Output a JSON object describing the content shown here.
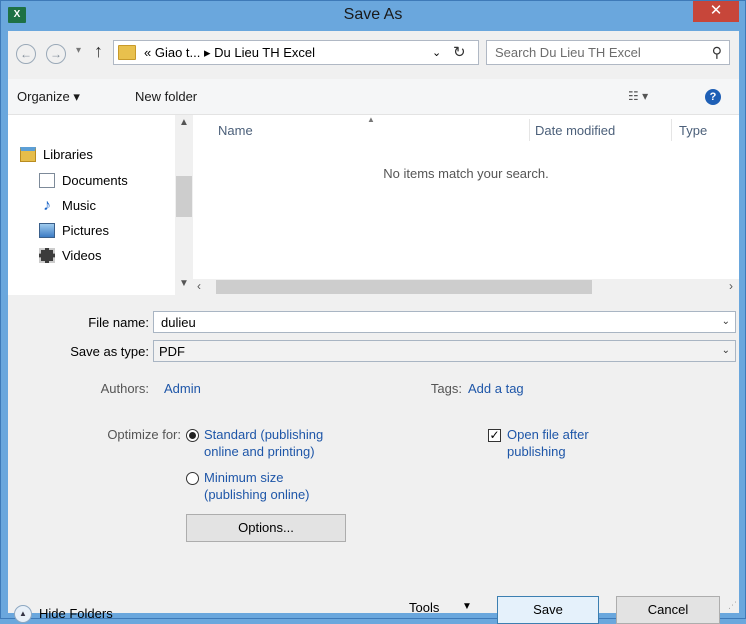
{
  "window": {
    "title": "Save As",
    "app_icon": "X",
    "close": "✕"
  },
  "address": {
    "path": "« Giao t... ▸ Du Lieu TH Excel",
    "search_placeholder": "Search Du Lieu TH Excel"
  },
  "toolbar": {
    "organize": "Organize ▾",
    "new_folder": "New folder"
  },
  "nav": {
    "items": [
      {
        "label": "Libraries",
        "icon": "libraries-icon"
      },
      {
        "label": "Documents",
        "icon": "documents-icon"
      },
      {
        "label": "Music",
        "icon": "music-icon"
      },
      {
        "label": "Pictures",
        "icon": "pictures-icon"
      },
      {
        "label": "Videos",
        "icon": "videos-icon"
      }
    ]
  },
  "files": {
    "columns": [
      "Name",
      "Date modified",
      "Type"
    ],
    "empty_message": "No items match your search."
  },
  "form": {
    "file_name_label": "File name:",
    "file_name_value": "dulieu",
    "save_type_label": "Save as type:",
    "save_type_value": "PDF",
    "authors_label": "Authors:",
    "authors_value": "Admin",
    "tags_label": "Tags:",
    "tags_value": "Add a tag",
    "optimize_label": "Optimize for:",
    "standard_line1": "Standard (publishing",
    "standard_line2": "online and printing)",
    "minimum_line1": "Minimum size",
    "minimum_line2": "(publishing online)",
    "open_after_line1": "Open file after",
    "open_after_line2": "publishing",
    "options_button": "Options..."
  },
  "footer": {
    "hide_folders": "Hide Folders",
    "tools": "Tools",
    "save": "Save",
    "cancel": "Cancel"
  }
}
